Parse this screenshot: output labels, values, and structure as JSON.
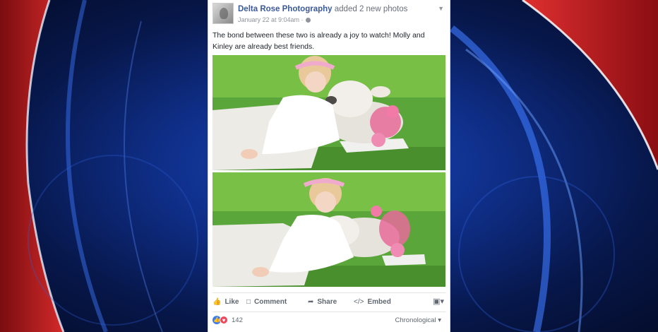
{
  "post": {
    "page_name": "Delta Rose Photography",
    "action": "added 2 new photos",
    "timestamp": "January 22 at 9:04am ·",
    "text": "The bond between these two is already a joy to watch! Molly and Kinley are already best friends."
  },
  "actions": {
    "like": "Like",
    "comment": "Comment",
    "share": "Share",
    "embed": "Embed"
  },
  "reactions": {
    "count": "142",
    "sort": "Chronological"
  },
  "colors": {
    "brand": "#3b5998",
    "like": "#3b7cf0",
    "love": "#f0475a",
    "bg_blue": "#1b46b8",
    "bg_red": "#c81e24"
  },
  "icons": [
    "globe-icon",
    "caret-down-icon",
    "like-icon",
    "comment-icon",
    "share-icon",
    "embed-icon",
    "share-menu-icon"
  ]
}
